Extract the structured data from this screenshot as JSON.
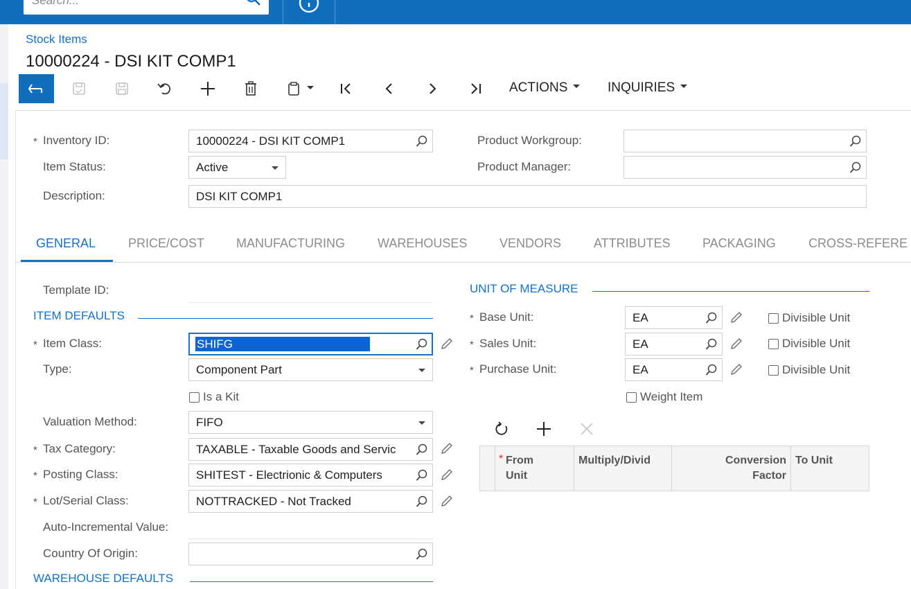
{
  "topbar": {
    "search_placeholder": "Search...",
    "search_icon": "search-icon",
    "clock_icon": "clock-icon"
  },
  "header": {
    "breadcrumb": "Stock Items",
    "title": "10000224 - DSI KIT COMP1"
  },
  "toolbar": {
    "actions_label": "ACTIONS",
    "inquiries_label": "INQUIRIES",
    "icons": [
      "back-icon",
      "save-close-icon",
      "save-icon",
      "undo-icon",
      "add-icon",
      "delete-icon",
      "clipboard-icon",
      "first-icon",
      "prev-icon",
      "next-icon",
      "last-icon"
    ]
  },
  "form": {
    "inventory_id_label": "Inventory ID:",
    "inventory_id_value": "10000224 - DSI KIT COMP1",
    "item_status_label": "Item Status:",
    "item_status_value": "Active",
    "description_label": "Description:",
    "description_value": "DSI KIT COMP1",
    "product_workgroup_label": "Product Workgroup:",
    "product_workgroup_value": "",
    "product_manager_label": "Product Manager:",
    "product_manager_value": "",
    "required_marker": "*"
  },
  "tabs": [
    "GENERAL",
    "PRICE/COST",
    "MANUFACTURING",
    "WAREHOUSES",
    "VENDORS",
    "ATTRIBUTES",
    "PACKAGING",
    "CROSS-REFERE"
  ],
  "general": {
    "template_id_label": "Template ID:",
    "item_defaults_title": "ITEM DEFAULTS",
    "item_class_label": "Item Class:",
    "item_class_value": "SHIFG",
    "type_label": "Type:",
    "type_value": "Component Part",
    "is_kit_label": "Is a Kit",
    "valuation_label": "Valuation Method:",
    "valuation_value": "FIFO",
    "tax_category_label": "Tax Category:",
    "tax_category_value": "TAXABLE - Taxable Goods and Servic",
    "posting_class_label": "Posting Class:",
    "posting_class_value": "SHITEST - Electrionic & Computers",
    "lot_serial_label": "Lot/Serial Class:",
    "lot_serial_value": "NOTTRACKED - Not Tracked",
    "auto_incremental_label": "Auto-Incremental Value:",
    "country_origin_label": "Country Of Origin:",
    "country_origin_value": "",
    "warehouse_defaults_title": "WAREHOUSE DEFAULTS"
  },
  "uom": {
    "title": "UNIT OF MEASURE",
    "base_unit_label": "Base Unit:",
    "base_unit_value": "EA",
    "sales_unit_label": "Sales Unit:",
    "sales_unit_value": "EA",
    "purchase_unit_label": "Purchase Unit:",
    "purchase_unit_value": "EA",
    "divisible_label": "Divisible Unit",
    "weight_item_label": "Weight Item",
    "grid_columns": {
      "from_unit": "From Unit",
      "multiply_divide": "Multiply/Divid",
      "conversion_factor": "Conversion Factor",
      "to_unit": "To Unit"
    }
  },
  "colors": {
    "brand": "#0f6ebd",
    "link": "#1570c6",
    "selection": "#0a64d6"
  }
}
